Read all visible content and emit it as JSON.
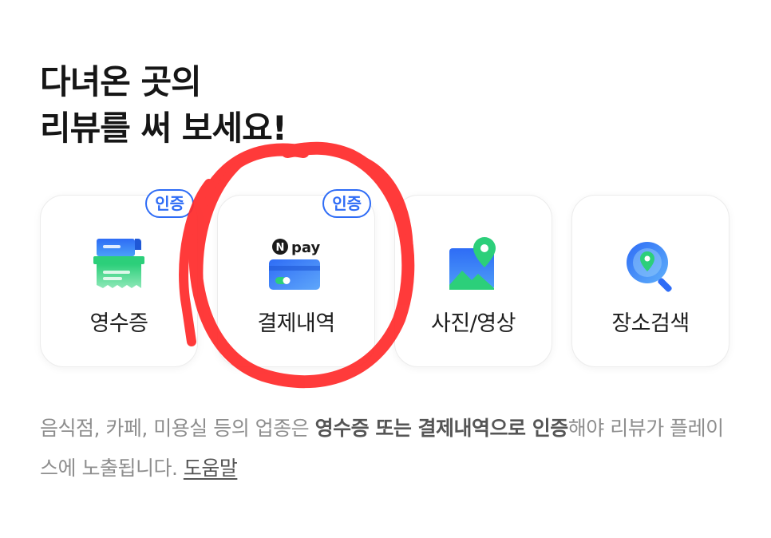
{
  "headline": {
    "line1": "다녀온 곳의",
    "line2": "리뷰를 써 보세요!"
  },
  "cards": [
    {
      "label": "영수증",
      "badge": "인증",
      "icon": "receipt-icon"
    },
    {
      "label": "결제내역",
      "badge": "인증",
      "icon": "npay-card-icon",
      "icon_text": "pay",
      "icon_logo_letter": "N"
    },
    {
      "label": "사진/영상",
      "icon": "photo-pin-icon"
    },
    {
      "label": "장소검색",
      "icon": "search-location-icon"
    }
  ],
  "notice": {
    "part1": "음식점, 카페, 미용실 등의 업종은 ",
    "bold1": "영수증 또는 결제내역으로 인증",
    "part2": "해야 리뷰가 플레이스에 노출됩니다. ",
    "help_link": "도움말"
  },
  "colors": {
    "accent": "#2e6cf6",
    "green": "#2ccf7a",
    "annotation_red": "#ff2a2a"
  }
}
